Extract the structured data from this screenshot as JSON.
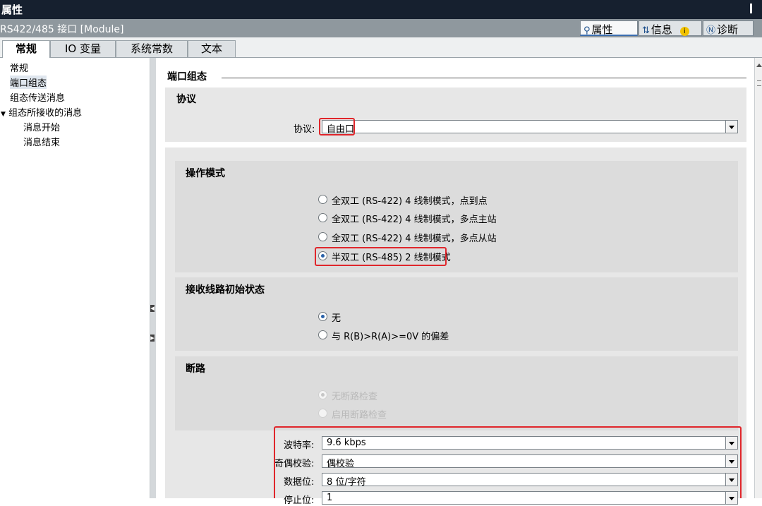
{
  "window": {
    "title": "属性"
  },
  "header": {
    "module": "RS422/485 接口 [Module]"
  },
  "top_tabs": [
    {
      "label": "属性",
      "icon": "properties-icon"
    },
    {
      "label": "信息",
      "icon": "info-icon"
    },
    {
      "label": "诊断",
      "icon": "diagnostics-icon"
    }
  ],
  "tabs": [
    {
      "label": "常规"
    },
    {
      "label": "IO 变量"
    },
    {
      "label": "系统常数"
    },
    {
      "label": "文本"
    }
  ],
  "nav": {
    "items": [
      {
        "label": "常规"
      },
      {
        "label": "端口组态",
        "selected": true
      },
      {
        "label": "组态传送消息"
      },
      {
        "label": "组态所接收的消息",
        "expanded": true
      },
      {
        "label": "消息开始"
      },
      {
        "label": "消息结束"
      }
    ]
  },
  "section": {
    "title": "端口组态"
  },
  "protocol": {
    "heading": "协议",
    "label": "协议:",
    "value": "自由口"
  },
  "operation_mode": {
    "heading": "操作模式",
    "options": [
      {
        "label": "全双工 (RS-422) 4 线制模式，点到点",
        "selected": false
      },
      {
        "label": "全双工 (RS-422) 4 线制模式，多点主站",
        "selected": false
      },
      {
        "label": "全双工 (RS-422) 4 线制模式，多点从站",
        "selected": false
      },
      {
        "label": "半双工 (RS-485) 2 线制模式",
        "selected": true
      }
    ]
  },
  "line_state": {
    "heading": "接收线路初始状态",
    "options": [
      {
        "label": "无",
        "selected": true
      },
      {
        "label": "与 R(B)>R(A)>=0V 的偏差",
        "selected": false
      }
    ]
  },
  "wire_break": {
    "heading": "断路",
    "options": [
      {
        "label": "无断路检查",
        "selected": true,
        "disabled": true
      },
      {
        "label": "启用断路检查",
        "selected": false,
        "disabled": true
      }
    ]
  },
  "settings": {
    "baud_label": "波特率:",
    "baud_value": "9.6 kbps",
    "parity_label": "奇偶校验:",
    "parity_value": "偶校验",
    "databits_label": "数据位:",
    "databits_value": "8 位/字符",
    "stopbits_label": "停止位:",
    "stopbits_value": "1"
  },
  "colors": {
    "highlight": "#e0262b",
    "title_bar": "#16202f",
    "header_bar": "#8f989e",
    "panel": "#e7e7e7"
  }
}
